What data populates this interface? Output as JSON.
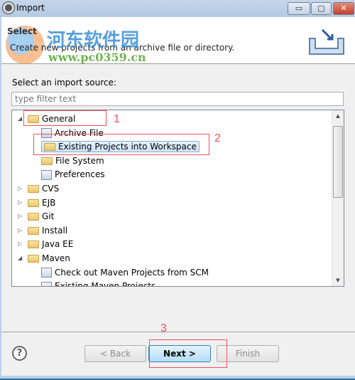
{
  "window": {
    "title": "Import",
    "minimize_label": "▭",
    "maximize_label": "▢",
    "close_label": "✕"
  },
  "header": {
    "title": "Select",
    "description": "Create new projects from an archive file or directory."
  },
  "watermark": {
    "text_cn": "河东软件园",
    "text_url": "www.pc0359.cn"
  },
  "main": {
    "source_label": "Select an import source:",
    "filter_placeholder": "type filter text",
    "tree": [
      {
        "label": "General",
        "expanded": true,
        "level": 0,
        "icon": "folder-icon"
      },
      {
        "label": "Archive File",
        "level": 1,
        "icon": "archive-icon"
      },
      {
        "label": "Existing Projects into Workspace",
        "level": 1,
        "icon": "project-folder-icon",
        "selected": true
      },
      {
        "label": "File System",
        "level": 1,
        "icon": "folder-icon"
      },
      {
        "label": "Preferences",
        "level": 1,
        "icon": "preferences-icon"
      },
      {
        "label": "CVS",
        "expanded": false,
        "level": 0,
        "icon": "folder-icon"
      },
      {
        "label": "EJB",
        "expanded": false,
        "level": 0,
        "icon": "folder-icon"
      },
      {
        "label": "Git",
        "expanded": false,
        "level": 0,
        "icon": "folder-icon"
      },
      {
        "label": "Install",
        "expanded": false,
        "level": 0,
        "icon": "folder-icon"
      },
      {
        "label": "Java EE",
        "expanded": false,
        "level": 0,
        "icon": "folder-icon"
      },
      {
        "label": "Maven",
        "expanded": true,
        "level": 0,
        "icon": "folder-icon"
      },
      {
        "label": "Check out Maven Projects from SCM",
        "level": 1,
        "icon": "maven-icon"
      },
      {
        "label": "Existing Maven Projects",
        "level": 1,
        "icon": "maven-icon"
      }
    ]
  },
  "footer": {
    "help_label": "?",
    "back_label": "< Back",
    "next_label": "Next >",
    "finish_label": "Finish"
  },
  "annotations": {
    "step1": "1",
    "step2": "2",
    "step3": "3",
    "color": "#f0505a"
  }
}
